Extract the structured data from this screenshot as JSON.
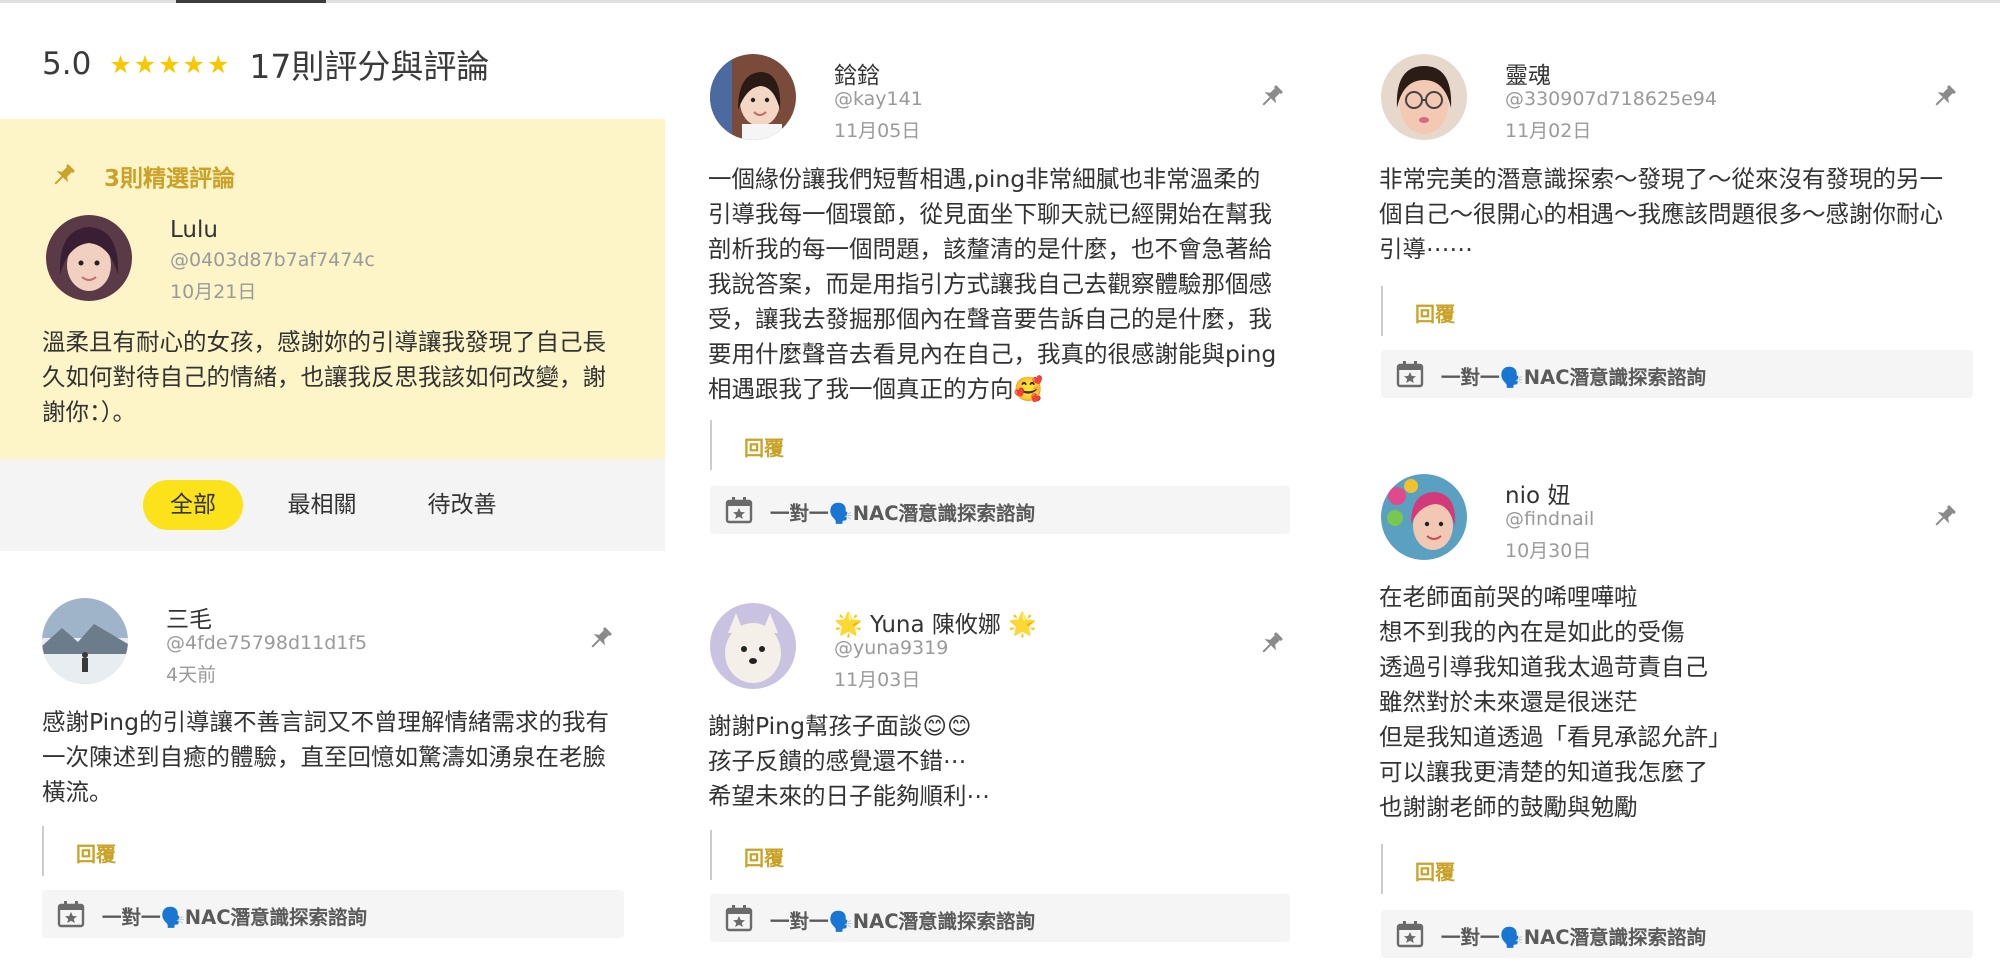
{
  "summary": {
    "score": "5.0",
    "stars": "★★★★★",
    "count_label": "17則評分與評論"
  },
  "featured": {
    "title": "3則精選評論"
  },
  "filters": [
    {
      "label": "全部",
      "active": true
    },
    {
      "label": "最相關",
      "active": false
    },
    {
      "label": "待改善",
      "active": false
    }
  ],
  "reply_label": "回覆",
  "service_label": "一對一🗣️NAC潛意識探索諮詢",
  "colors": {
    "accent_gold": "#c9a227",
    "star_yellow": "#f6c800",
    "featured_bg": "#fdf4c8",
    "chip_active": "#fbe21a"
  },
  "reviews": {
    "lulu": {
      "name": "Lulu",
      "handle": "@0403d87b7af7474c",
      "date": "10月21日",
      "body": "溫柔且有耐心的女孩，感謝妳的引導讓我發現了自己長\n久如何對待自己的情緒，也讓我反思我該如何改變，謝\n謝你：）。"
    },
    "sanmao": {
      "name": "三毛",
      "handle": "@4fde75798d11d1f5",
      "date": "4天前",
      "body": "感謝Ping的引導讓不善言詞又不曾理解情緒需求的我有\n一次陳述到自癒的體驗，直至回憶如驚濤如湧泉在老臉\n橫流。"
    },
    "qinqin": {
      "name": "鋡鋡",
      "handle": "@kay141",
      "date": "11月05日",
      "body": "一個緣份讓我們短暫相遇,ping非常細膩也非常溫柔的\n引導我每一個環節，從見面坐下聊天就已經開始在幫我\n剖析我的每一個問題，該釐清的是什麼，也不會急著給\n我說答案，而是用指引方式讓我自己去觀察體驗那個感\n受，讓我去發掘那個內在聲音要告訴自己的是什麼，我\n要用什麼聲音去看見內在自己，我真的很感謝能與ping\n相遇跟我了我一個真正的方向🥰"
    },
    "yuna": {
      "name": "🌟 Yuna 陳攸娜 🌟",
      "handle": "@yuna9319",
      "date": "11月03日",
      "body": "謝謝Ping幫孩子面談😊😊\n孩子反饋的感覺還不錯⋯\n希望未來的日子能夠順利⋯"
    },
    "linghun": {
      "name": "靈魂",
      "handle": "@330907d718625e94",
      "date": "11月02日",
      "body": "非常完美的潛意識探索～發現了～從來沒有發現的另一\n個自己～很開心的相遇～我應該問題很多～感謝你耐心\n引導⋯⋯"
    },
    "nio": {
      "name": "nio 妞",
      "handle": "@findnail",
      "date": "10月30日",
      "body": "在老師面前哭的唏哩嘩啦\n想不到我的內在是如此的受傷\n透過引導我知道我太過苛責自己\n雖然對於未來還是很迷茫\n但是我知道透過「看見承認允許」\n可以讓我更清楚的知道我怎麼了\n也謝謝老師的鼓勵與勉勵"
    }
  }
}
